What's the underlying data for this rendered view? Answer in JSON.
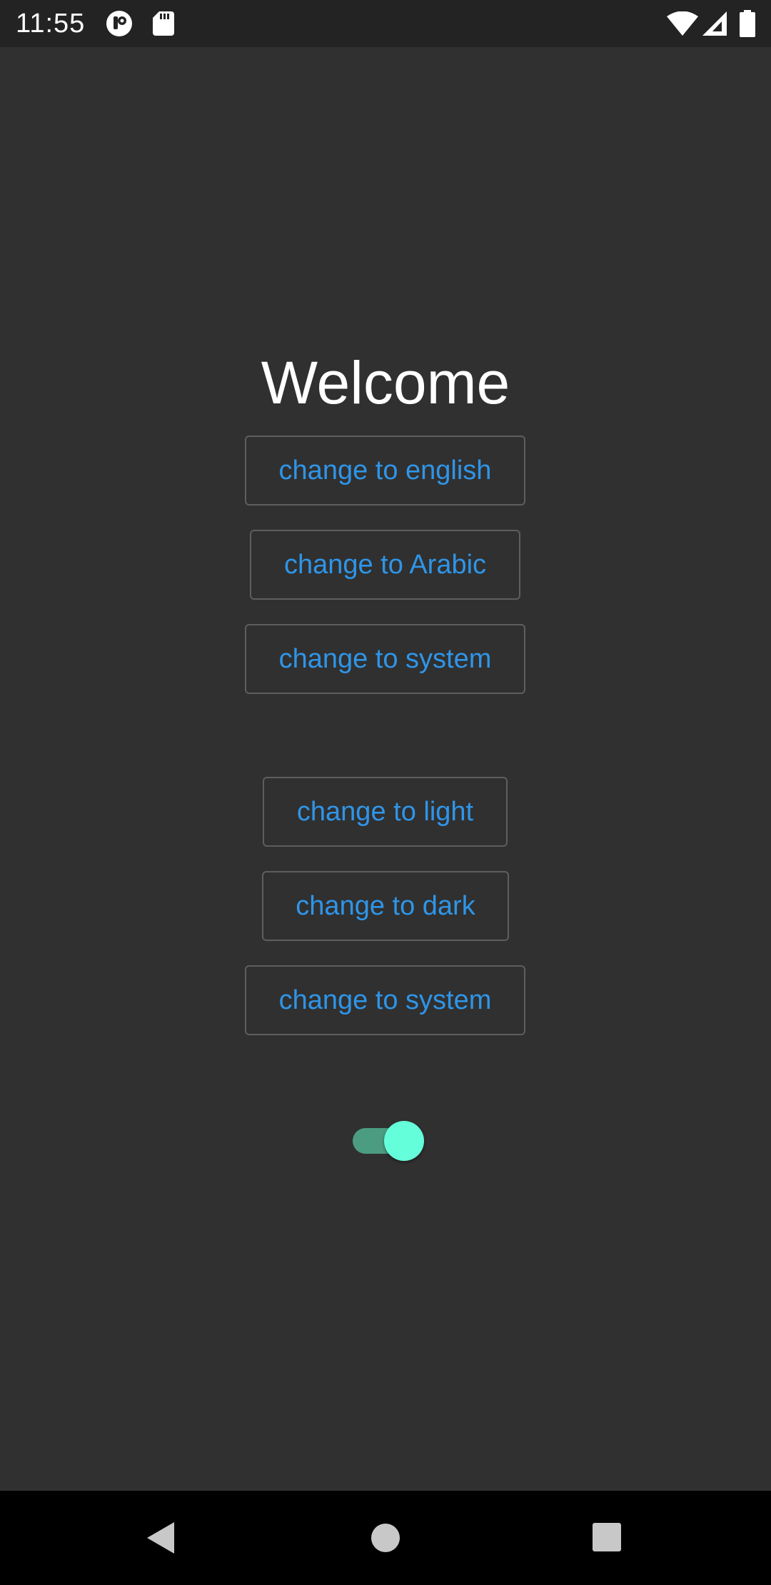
{
  "status_bar": {
    "time": "11:55",
    "icons": [
      "app-notification-icon",
      "sd-card-icon",
      "wifi-icon",
      "cell-signal-icon",
      "battery-icon"
    ]
  },
  "main": {
    "title": "Welcome",
    "language_buttons": [
      {
        "label": "change to english"
      },
      {
        "label": "change to Arabic"
      },
      {
        "label": "change to system"
      }
    ],
    "theme_buttons": [
      {
        "label": "change to light"
      },
      {
        "label": "change to dark"
      },
      {
        "label": "change to system"
      }
    ],
    "toggle": {
      "on": true
    }
  },
  "nav_bar": {
    "buttons": [
      "back-icon",
      "home-icon",
      "recents-icon"
    ]
  },
  "colors": {
    "background": "#303030",
    "status_bar": "#232323",
    "button_text": "#2f95e8",
    "button_border": "#5e5e5e",
    "toggle_thumb": "#64ffda",
    "toggle_track": "#4c9c82",
    "nav_bar": "#000000"
  }
}
